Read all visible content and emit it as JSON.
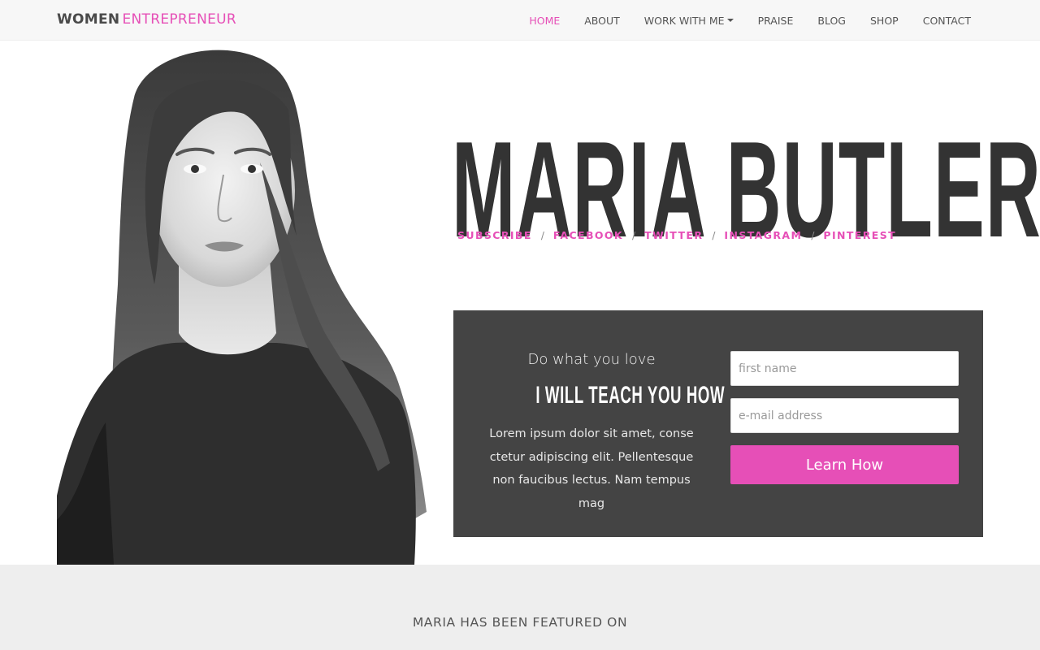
{
  "brand": {
    "part1": "WOMEN",
    "part2": "ENTREPRENEUR"
  },
  "nav": {
    "items": [
      {
        "label": "HOME",
        "active": true
      },
      {
        "label": "ABOUT"
      },
      {
        "label": "WORK WITH ME",
        "has_dropdown": true
      },
      {
        "label": "PRAISE"
      },
      {
        "label": "BLOG"
      },
      {
        "label": "SHOP"
      },
      {
        "label": "CONTACT"
      }
    ]
  },
  "hero": {
    "name": "MARIA BUTLER",
    "social": [
      {
        "label": "SUBSCRIBE"
      },
      {
        "label": "FACEBOOK"
      },
      {
        "label": "TWITTER"
      },
      {
        "label": "INSTAGRAM"
      },
      {
        "label": "PINTEREST"
      }
    ],
    "separator": "/",
    "photo_alt": "portrait-photo"
  },
  "optin": {
    "tagline": "Do what you love",
    "headline": "I WILL TEACH YOU HOW",
    "body": "Lorem ipsum dolor sit amet, conse ctetur adipiscing elit. Pellentesque non faucibus lectus. Nam tempus mag",
    "first_name": {
      "value": "",
      "placeholder": "first name"
    },
    "email": {
      "value": "",
      "placeholder": "e-mail address"
    },
    "button_label": "Learn How"
  },
  "featured": {
    "title": "MARIA HAS BEEN FEATURED ON"
  },
  "colors": {
    "accent": "#e64fb7",
    "dark": "#444444",
    "navbar": "#f7f7f7",
    "featured_bg": "#eeeeee"
  }
}
